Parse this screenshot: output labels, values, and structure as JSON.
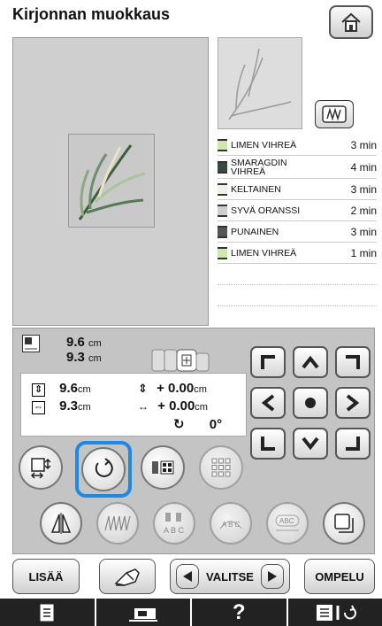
{
  "header": {
    "title": "Kirjonnan muokkaus"
  },
  "threads": [
    {
      "name": "LIMEN VIHREÄ",
      "time": "3 min",
      "color": "#cfe8b0"
    },
    {
      "name": "SMARAGDIN VIHREÄ",
      "time": "4 min",
      "color": "#3a4a3a"
    },
    {
      "name": "KELTAINEN",
      "time": "3 min",
      "color": "#f1f1e9"
    },
    {
      "name": "SYVÄ ORANSSI",
      "time": "2 min",
      "color": "#cfcfcf"
    },
    {
      "name": "PUNAINEN",
      "time": "3 min",
      "color": "#555"
    },
    {
      "name": "LIMEN VIHREÄ",
      "time": "1 min",
      "color": "#cfe8b0"
    }
  ],
  "size": {
    "width": "9.6",
    "height": "9.3",
    "unit": "cm"
  },
  "info": {
    "height_val": "9.6",
    "width_val": "9.3",
    "unit": "cm",
    "offset_v": "+ 0.00",
    "offset_h": "+ 0.00",
    "rotation": "0°"
  },
  "footer": {
    "add_label": "LISÄÄ",
    "select_label": "VALITSE",
    "sew_label": "OMPELU"
  },
  "bottombar": {
    "help": "?"
  }
}
